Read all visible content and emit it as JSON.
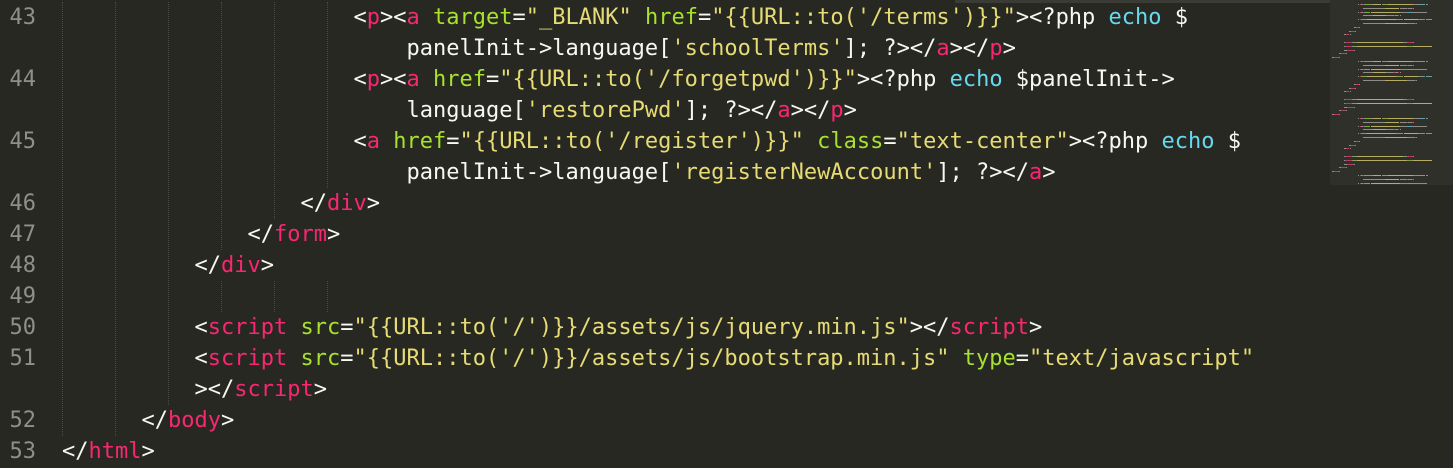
{
  "editor": {
    "theme": "monokai",
    "colors": {
      "background": "#272822",
      "tag": "#f92672",
      "attribute": "#a6e22e",
      "string": "#e6db74",
      "keyword": "#66d9ef",
      "text": "#f8f8f2",
      "line_number": "#90908a"
    },
    "line_numbers": [
      "43",
      "44",
      "45",
      "46",
      "47",
      "48",
      "49",
      "50",
      "51",
      "52",
      "53"
    ],
    "rows": [
      [
        [
          "t",
          "<"
        ],
        [
          "g",
          "p"
        ],
        [
          "t",
          "><"
        ],
        [
          "g",
          "a"
        ],
        [
          "t",
          " "
        ],
        [
          "a",
          "target"
        ],
        [
          "t",
          "="
        ],
        [
          "s",
          "\"_BLANK\""
        ],
        [
          "t",
          " "
        ],
        [
          "a",
          "href"
        ],
        [
          "t",
          "="
        ],
        [
          "s",
          "\"{{URL::to('/terms')}}\""
        ],
        [
          "t",
          "><?php "
        ],
        [
          "k",
          "echo"
        ],
        [
          "t",
          " $"
        ]
      ],
      [
        [
          "t",
          "panelInit->language["
        ],
        [
          "s",
          "'schoolTerms'"
        ],
        [
          "t",
          "]; ?></"
        ],
        [
          "g",
          "a"
        ],
        [
          "t",
          "></"
        ],
        [
          "g",
          "p"
        ],
        [
          "t",
          ">"
        ]
      ],
      [
        [
          "t",
          "<"
        ],
        [
          "g",
          "p"
        ],
        [
          "t",
          "><"
        ],
        [
          "g",
          "a"
        ],
        [
          "t",
          " "
        ],
        [
          "a",
          "href"
        ],
        [
          "t",
          "="
        ],
        [
          "s",
          "\"{{URL::to('/forgetpwd')}}\""
        ],
        [
          "t",
          "><?php "
        ],
        [
          "k",
          "echo"
        ],
        [
          "t",
          " $panelInit->"
        ]
      ],
      [
        [
          "t",
          "language["
        ],
        [
          "s",
          "'restorePwd'"
        ],
        [
          "t",
          "]; ?></"
        ],
        [
          "g",
          "a"
        ],
        [
          "t",
          "></"
        ],
        [
          "g",
          "p"
        ],
        [
          "t",
          ">"
        ]
      ],
      [
        [
          "t",
          "<"
        ],
        [
          "g",
          "a"
        ],
        [
          "t",
          " "
        ],
        [
          "a",
          "href"
        ],
        [
          "t",
          "="
        ],
        [
          "s",
          "\"{{URL::to('/register')}}\""
        ],
        [
          "t",
          " "
        ],
        [
          "a",
          "class"
        ],
        [
          "t",
          "="
        ],
        [
          "s",
          "\"text-center\""
        ],
        [
          "t",
          "><?php "
        ],
        [
          "k",
          "echo"
        ],
        [
          "t",
          " $"
        ]
      ],
      [
        [
          "t",
          "panelInit->language["
        ],
        [
          "s",
          "'registerNewAccount'"
        ],
        [
          "t",
          "]; ?></"
        ],
        [
          "g",
          "a"
        ],
        [
          "t",
          ">"
        ]
      ],
      [
        [
          "t",
          "</"
        ],
        [
          "g",
          "div"
        ],
        [
          "t",
          ">"
        ]
      ],
      [
        [
          "t",
          "</"
        ],
        [
          "g",
          "form"
        ],
        [
          "t",
          ">"
        ]
      ],
      [
        [
          "t",
          "</"
        ],
        [
          "g",
          "div"
        ],
        [
          "t",
          ">"
        ]
      ],
      [],
      [
        [
          "t",
          "<"
        ],
        [
          "g",
          "script"
        ],
        [
          "t",
          " "
        ],
        [
          "a",
          "src"
        ],
        [
          "t",
          "="
        ],
        [
          "s",
          "\"{{URL::to('/')}}/assets/js/jquery.min.js\""
        ],
        [
          "t",
          "></"
        ],
        [
          "g",
          "script"
        ],
        [
          "t",
          ">"
        ]
      ],
      [
        [
          "t",
          "<"
        ],
        [
          "g",
          "script"
        ],
        [
          "t",
          " "
        ],
        [
          "a",
          "src"
        ],
        [
          "t",
          "="
        ],
        [
          "s",
          "\"{{URL::to('/')}}/assets/js/bootstrap.min.js\""
        ],
        [
          "t",
          " "
        ],
        [
          "a",
          "type"
        ],
        [
          "t",
          "="
        ],
        [
          "s",
          "\"text/javascript\""
        ]
      ],
      [
        [
          "t",
          "></"
        ],
        [
          "g",
          "script"
        ],
        [
          "t",
          ">"
        ]
      ],
      [
        [
          "t",
          "</"
        ],
        [
          "g",
          "body"
        ],
        [
          "t",
          ">"
        ]
      ],
      [
        [
          "t",
          "</"
        ],
        [
          "g",
          "html"
        ],
        [
          "t",
          ">"
        ]
      ]
    ]
  }
}
